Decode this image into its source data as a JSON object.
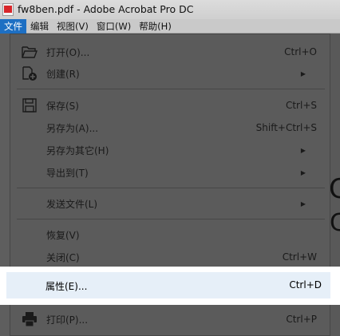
{
  "window": {
    "title": "fw8ben.pdf - Adobe Acrobat Pro DC"
  },
  "menubar": {
    "items": [
      {
        "label": "文件",
        "active": true
      },
      {
        "label": "编辑"
      },
      {
        "label": "视图(V)"
      },
      {
        "label": "窗口(W)"
      },
      {
        "label": "帮助(H)"
      }
    ]
  },
  "file_menu": {
    "open": {
      "label": "打开(O)...",
      "shortcut": "Ctrl+O",
      "icon": "folder-open-icon"
    },
    "create": {
      "label": "创建(R)",
      "submenu": true,
      "icon": "create-document-icon"
    },
    "save": {
      "label": "保存(S)",
      "shortcut": "Ctrl+S",
      "icon": "floppy-disk-icon"
    },
    "save_as": {
      "label": "另存为(A)...",
      "shortcut": "Shift+Ctrl+S"
    },
    "save_as_other": {
      "label": "另存为其它(H)",
      "submenu": true
    },
    "export_to": {
      "label": "导出到(T)",
      "submenu": true
    },
    "send_file": {
      "label": "发送文件(L)",
      "submenu": true
    },
    "revert": {
      "label": "恢复(V)"
    },
    "close": {
      "label": "关闭(C)",
      "shortcut": "Ctrl+W"
    },
    "properties": {
      "label": "属性(E)...",
      "shortcut": "Ctrl+D",
      "highlighted": true
    },
    "print": {
      "label": "打印(P)...",
      "shortcut": "Ctrl+P",
      "icon": "printer-icon"
    },
    "arrow_glyph": "▶"
  },
  "background": {
    "partial_text": "C",
    "partial_text_2": "C"
  },
  "colors": {
    "menu_active": "#1d6fc3",
    "dimmed_menu": "#5b5b5b",
    "highlight": "#e6eff8"
  }
}
